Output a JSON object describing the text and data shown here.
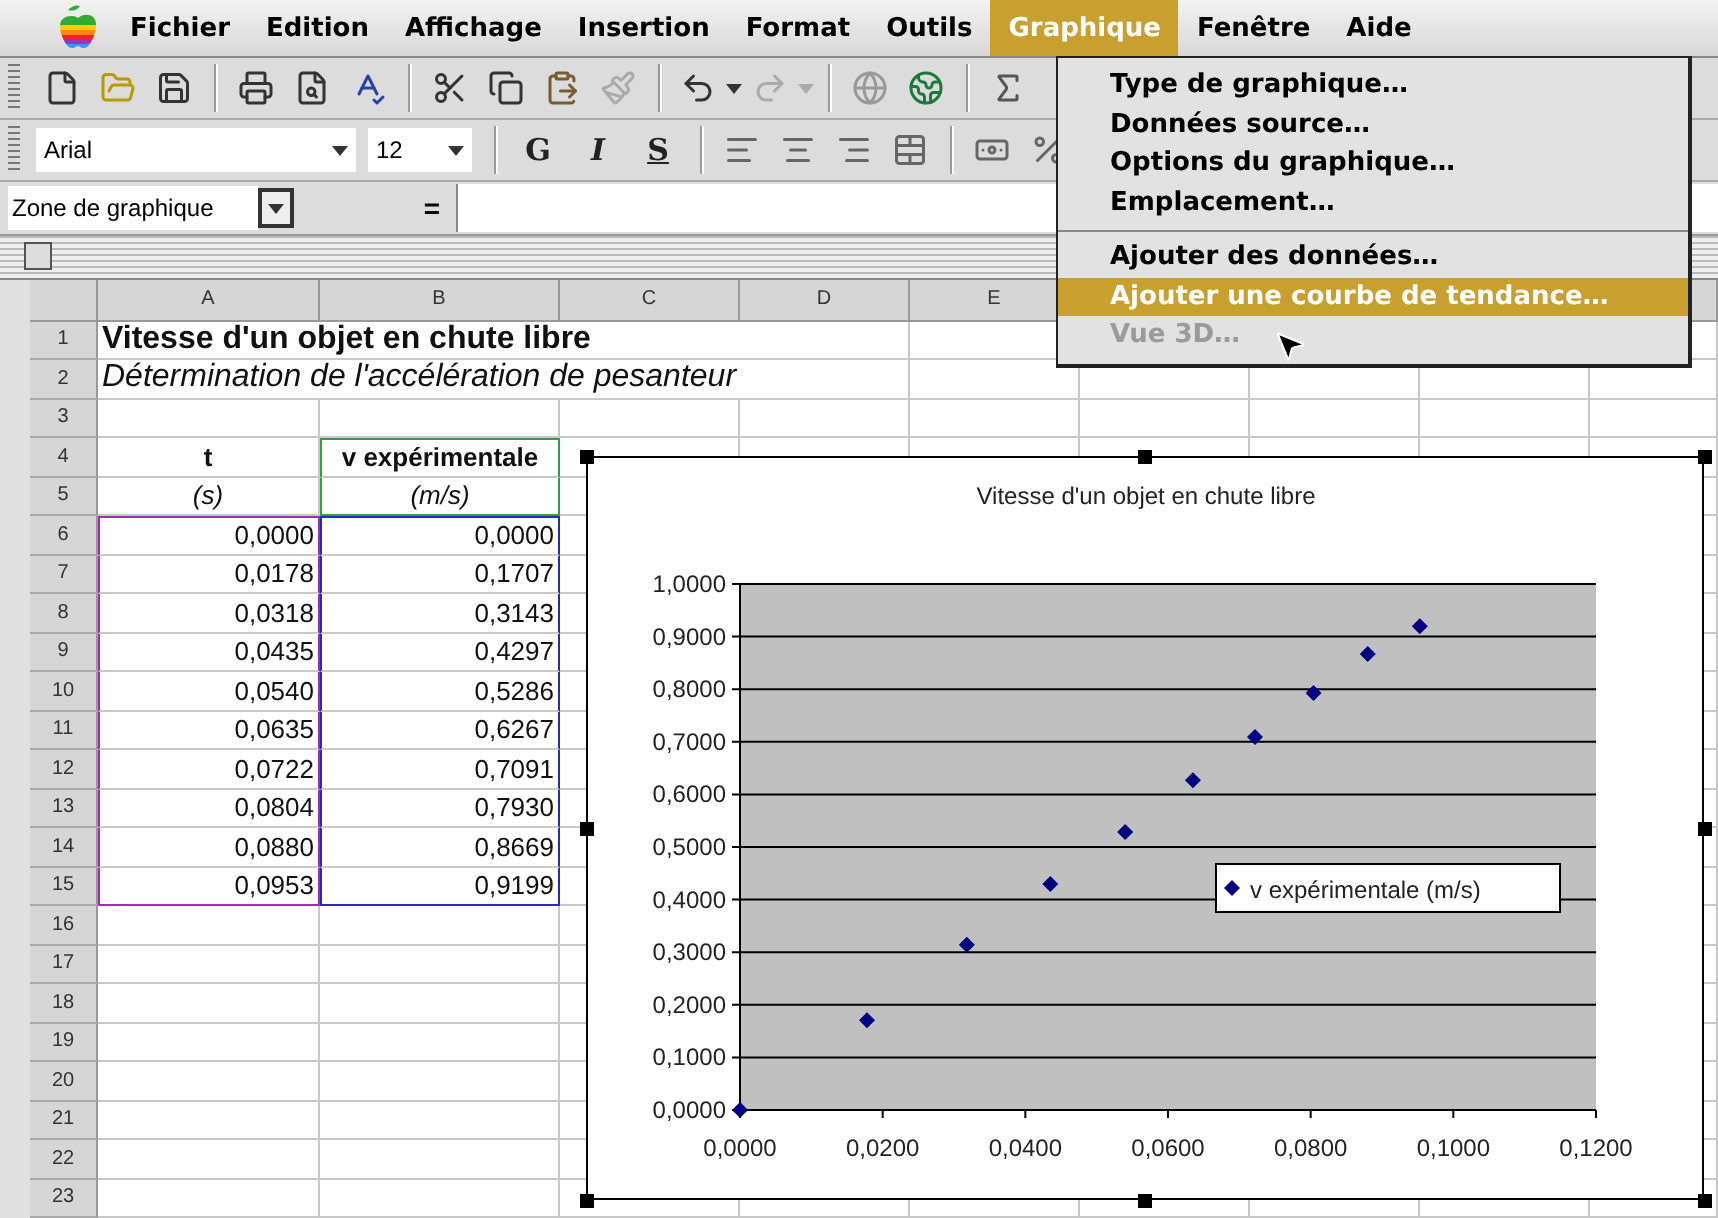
{
  "menu_bar": {
    "items": [
      {
        "label": "Fichier",
        "selected": false
      },
      {
        "label": "Edition",
        "selected": false
      },
      {
        "label": "Affichage",
        "selected": false
      },
      {
        "label": "Insertion",
        "selected": false
      },
      {
        "label": "Format",
        "selected": false
      },
      {
        "label": "Outils",
        "selected": false
      },
      {
        "label": "Graphique",
        "selected": true
      },
      {
        "label": "Fenêtre",
        "selected": false
      },
      {
        "label": "Aide",
        "selected": false
      }
    ]
  },
  "open_menu": {
    "groups": [
      [
        {
          "label": "Type de graphique…",
          "selected": false,
          "disabled": false
        },
        {
          "label": "Données source…",
          "selected": false,
          "disabled": false
        },
        {
          "label": "Options du graphique…",
          "selected": false,
          "disabled": false
        },
        {
          "label": "Emplacement…",
          "selected": false,
          "disabled": false
        }
      ],
      [
        {
          "label": "Ajouter des données…",
          "selected": false,
          "disabled": false
        },
        {
          "label": "Ajouter une courbe de tendance…",
          "selected": true,
          "disabled": false
        },
        {
          "label": "Vue 3D…",
          "selected": false,
          "disabled": true
        }
      ]
    ]
  },
  "font_toolbar": {
    "font": "Arial",
    "size": "12",
    "style_buttons": [
      "G",
      "I",
      "S"
    ]
  },
  "formula_bar": {
    "name_box": "Zone de graphique",
    "equals": "="
  },
  "sheet": {
    "columns": [
      {
        "letter": "A"
      },
      {
        "letter": "B"
      },
      {
        "letter": "C"
      },
      {
        "letter": "D"
      },
      {
        "letter": "E"
      }
    ],
    "ranges": [
      {
        "kind": "x_values",
        "color": "#a030a8"
      },
      {
        "kind": "y_values",
        "color": "#2828c8"
      },
      {
        "kind": "series_name",
        "color": "#30a040"
      }
    ],
    "rows": [
      {
        "number": "1",
        "kind": "title",
        "text": "Vitesse d'un objet en chute libre"
      },
      {
        "number": "2",
        "kind": "subtitle",
        "text": "Détermination de l'accélération de pesanteur"
      },
      {
        "number": "3",
        "kind": "empty"
      },
      {
        "number": "4",
        "kind": "header",
        "cells": [
          "t",
          "v expérimentale"
        ]
      },
      {
        "number": "5",
        "kind": "units",
        "cells": [
          "(s)",
          "(m/s)"
        ]
      },
      {
        "number": "6",
        "kind": "data",
        "cells": [
          "0,0000",
          "0,0000"
        ]
      },
      {
        "number": "7",
        "kind": "data",
        "cells": [
          "0,0178",
          "0,1707"
        ]
      },
      {
        "number": "8",
        "kind": "data",
        "cells": [
          "0,0318",
          "0,3143"
        ]
      },
      {
        "number": "9",
        "kind": "data",
        "cells": [
          "0,0435",
          "0,4297"
        ]
      },
      {
        "number": "10",
        "kind": "data",
        "cells": [
          "0,0540",
          "0,5286"
        ]
      },
      {
        "number": "11",
        "kind": "data",
        "cells": [
          "0,0635",
          "0,6267"
        ]
      },
      {
        "number": "12",
        "kind": "data",
        "cells": [
          "0,0722",
          "0,7091"
        ]
      },
      {
        "number": "13",
        "kind": "data",
        "cells": [
          "0,0804",
          "0,7930"
        ]
      },
      {
        "number": "14",
        "kind": "data",
        "cells": [
          "0,0880",
          "0,8669"
        ]
      },
      {
        "number": "15",
        "kind": "data",
        "cells": [
          "0,0953",
          "0,9199"
        ]
      },
      {
        "number": "16",
        "kind": "empty"
      },
      {
        "number": "17",
        "kind": "empty"
      },
      {
        "number": "18",
        "kind": "empty"
      },
      {
        "number": "19",
        "kind": "empty"
      },
      {
        "number": "20",
        "kind": "empty"
      },
      {
        "number": "21",
        "kind": "empty"
      },
      {
        "number": "22",
        "kind": "empty"
      },
      {
        "number": "23",
        "kind": "empty"
      }
    ]
  },
  "chart": {
    "chart_data": {
      "type": "scatter",
      "grid": true,
      "title": "Vitesse d'un objet en chute libre",
      "x": [
        0,
        0.0178,
        0.0318,
        0.0435,
        0.054,
        0.0635,
        0.0722,
        0.0804,
        0.088,
        0.0953
      ],
      "series": [
        {
          "name": "v expérimentale (m/s)",
          "color": "#000080",
          "values": [
            0,
            0.1707,
            0.3143,
            0.4297,
            0.5286,
            0.6267,
            0.7091,
            0.793,
            0.8669,
            0.9199
          ]
        }
      ],
      "xlim": [
        0,
        0.12
      ],
      "ylim": [
        0,
        1
      ],
      "xticks": [
        {
          "value": 0,
          "label": "0,0000"
        },
        {
          "value": 0.02,
          "label": "0,0200"
        },
        {
          "value": 0.04,
          "label": "0,0400"
        },
        {
          "value": 0.06,
          "label": "0,0600"
        },
        {
          "value": 0.08,
          "label": "0,0800"
        },
        {
          "value": 0.1,
          "label": "0,1000"
        },
        {
          "value": 0.12,
          "label": "0,1200"
        }
      ],
      "yticks": [
        {
          "value": 0,
          "label": "0,0000"
        },
        {
          "value": 0.1,
          "label": "0,1000"
        },
        {
          "value": 0.2,
          "label": "0,2000"
        },
        {
          "value": 0.3,
          "label": "0,3000"
        },
        {
          "value": 0.4,
          "label": "0,4000"
        },
        {
          "value": 0.5,
          "label": "0,5000"
        },
        {
          "value": 0.6,
          "label": "0,6000"
        },
        {
          "value": 0.7,
          "label": "0,7000"
        },
        {
          "value": 0.8,
          "label": "0,8000"
        },
        {
          "value": 0.9,
          "label": "0,9000"
        },
        {
          "value": 1,
          "label": "1,0000"
        }
      ]
    }
  }
}
